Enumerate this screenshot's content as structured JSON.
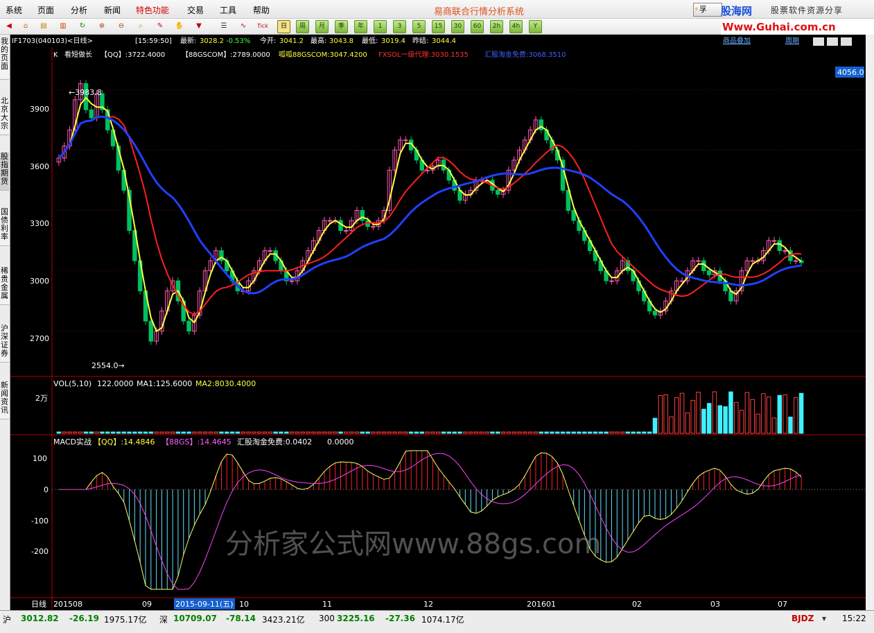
{
  "menu": [
    "系统",
    "页面",
    "分析",
    "新闻",
    "特色功能",
    "交易",
    "工具",
    "帮助"
  ],
  "app_title": "易商联合行情分析系统",
  "brand": "股海网",
  "brand_tag": "股票软件资源分享",
  "brand_url": "Www.Guhai.com.cn",
  "search_btn": "孚",
  "periods": [
    "日",
    "周",
    "月",
    "季",
    "年",
    "1",
    "3",
    "5",
    "15",
    "30",
    "60",
    "2h",
    "4h",
    "Y"
  ],
  "sidebar_tabs": [
    "我的页面",
    "北京大宗",
    "股指期货",
    "国债利率",
    "稀贵金属",
    "沪深证券",
    "新闻资讯"
  ],
  "quote": {
    "code": "IF1703(040103)<日线>",
    "time": "[15:59:50]",
    "latest_label": "最新:",
    "latest": "3028.2",
    "change": "-0.53%",
    "open_label": "今开:",
    "open": "3041.2",
    "high_label": "最高:",
    "high": "3043.8",
    "low_label": "最低:",
    "low": "3019.4",
    "prev_label": "昨结:",
    "prev": "3044.4"
  },
  "top_links": [
    "商品叠加",
    "周期"
  ],
  "price_scale_box": "4056.0",
  "k_legend": {
    "k": "K",
    "name": "看短做长",
    "qq": "【QQ】:3722.4000",
    "gs": "【88GSCOM】:2789.0000",
    "b": "呱呱88GSCOM:3047.4200",
    "fx": "FXSOL一级代理:3030.1535",
    "hg": "汇股淘金免费:3068.3510"
  },
  "price_axis": [
    "3900",
    "3600",
    "3300",
    "3000",
    "2700"
  ],
  "high_mark": "←3983.8",
  "low_mark": "2554.0→",
  "vol_legend": {
    "name": "VOL(5,10)",
    "v": "122.0000",
    "ma1": "MA1:125.6000",
    "ma2": "MA2:8030.4000"
  },
  "vol_axis": "2万",
  "macd_legend": {
    "name": "MACD实战",
    "qq": "【QQ】:14.4846",
    "gs": "【88GS】:14.4645",
    "hg": "汇股淘金免费:0.0402",
    "z": "0.0000"
  },
  "macd_axis": [
    "100",
    "0",
    "-100",
    "-200"
  ],
  "watermark": "分析家公式网www.88gs.com",
  "date_axis": {
    "label": "日线",
    "ticks": [
      "201508",
      "09",
      "10",
      "11",
      "12",
      "201601",
      "02",
      "03",
      "07"
    ],
    "highlight": "2015-09-11(五)"
  },
  "status": {
    "sh_label": "沪",
    "sh": "3012.82",
    "sh_chg": "-26.19",
    "sh_amt": "1975.17亿",
    "sz_label": "深",
    "sz": "10709.07",
    "sz_chg": "-78.14",
    "sz_amt": "3423.21亿",
    "c300_label": "300",
    "c300": "3225.16",
    "c300_chg": "-27.36",
    "c300_amt": "1074.17亿",
    "code": "BJDZ",
    "time": "15:22"
  },
  "colors": {
    "up": "#ff5ab4",
    "down": "#00c060",
    "ma_yellow": "#ffff40",
    "ma_red": "#ff2020",
    "ma_blue": "#2040ff",
    "vol_cyan": "#40f0ff",
    "vol_red": "#ff4040"
  },
  "chart_data": {
    "type": "candlestick",
    "price_range": [
      2554.0,
      3983.8
    ],
    "series_closes": [
      3560,
      3620,
      3700,
      3850,
      3930,
      3800,
      3760,
      3880,
      3800,
      3700,
      3620,
      3500,
      3400,
      3200,
      3050,
      2900,
      2750,
      2650,
      2700,
      2800,
      2900,
      2950,
      2850,
      2750,
      2700,
      2780,
      2900,
      3000,
      3050,
      3100,
      3050,
      3000,
      2950,
      2900,
      2900,
      2950,
      3000,
      3050,
      3100,
      3100,
      3050,
      3000,
      2950,
      2950,
      3000,
      3050,
      3100,
      3150,
      3200,
      3250,
      3250,
      3250,
      3200,
      3200,
      3250,
      3300,
      3250,
      3220,
      3220,
      3250,
      3300,
      3500,
      3600,
      3650,
      3650,
      3600,
      3550,
      3500,
      3500,
      3520,
      3550,
      3500,
      3450,
      3400,
      3350,
      3380,
      3400,
      3450,
      3450,
      3450,
      3400,
      3380,
      3400,
      3500,
      3550,
      3600,
      3650,
      3700,
      3750,
      3700,
      3650,
      3600,
      3550,
      3400,
      3300,
      3250,
      3200,
      3150,
      3100,
      3050,
      3000,
      2950,
      2950,
      3000,
      3050,
      3000,
      2950,
      2900,
      2850,
      2800,
      2780,
      2800,
      2850,
      2900,
      2950,
      2950,
      3000,
      3050,
      3050,
      3000,
      2980,
      3000,
      2950,
      2900,
      2850,
      2900,
      3000,
      3050,
      3050,
      3050,
      3100,
      3150,
      3150,
      3100,
      3100,
      3050,
      3050,
      3040
    ],
    "ma_legend": [
      "QQ:3722.4000",
      "88GSCOM:2789.0000",
      "88GSCOM:3047.4200",
      "3030.1535",
      "3068.3510"
    ]
  }
}
